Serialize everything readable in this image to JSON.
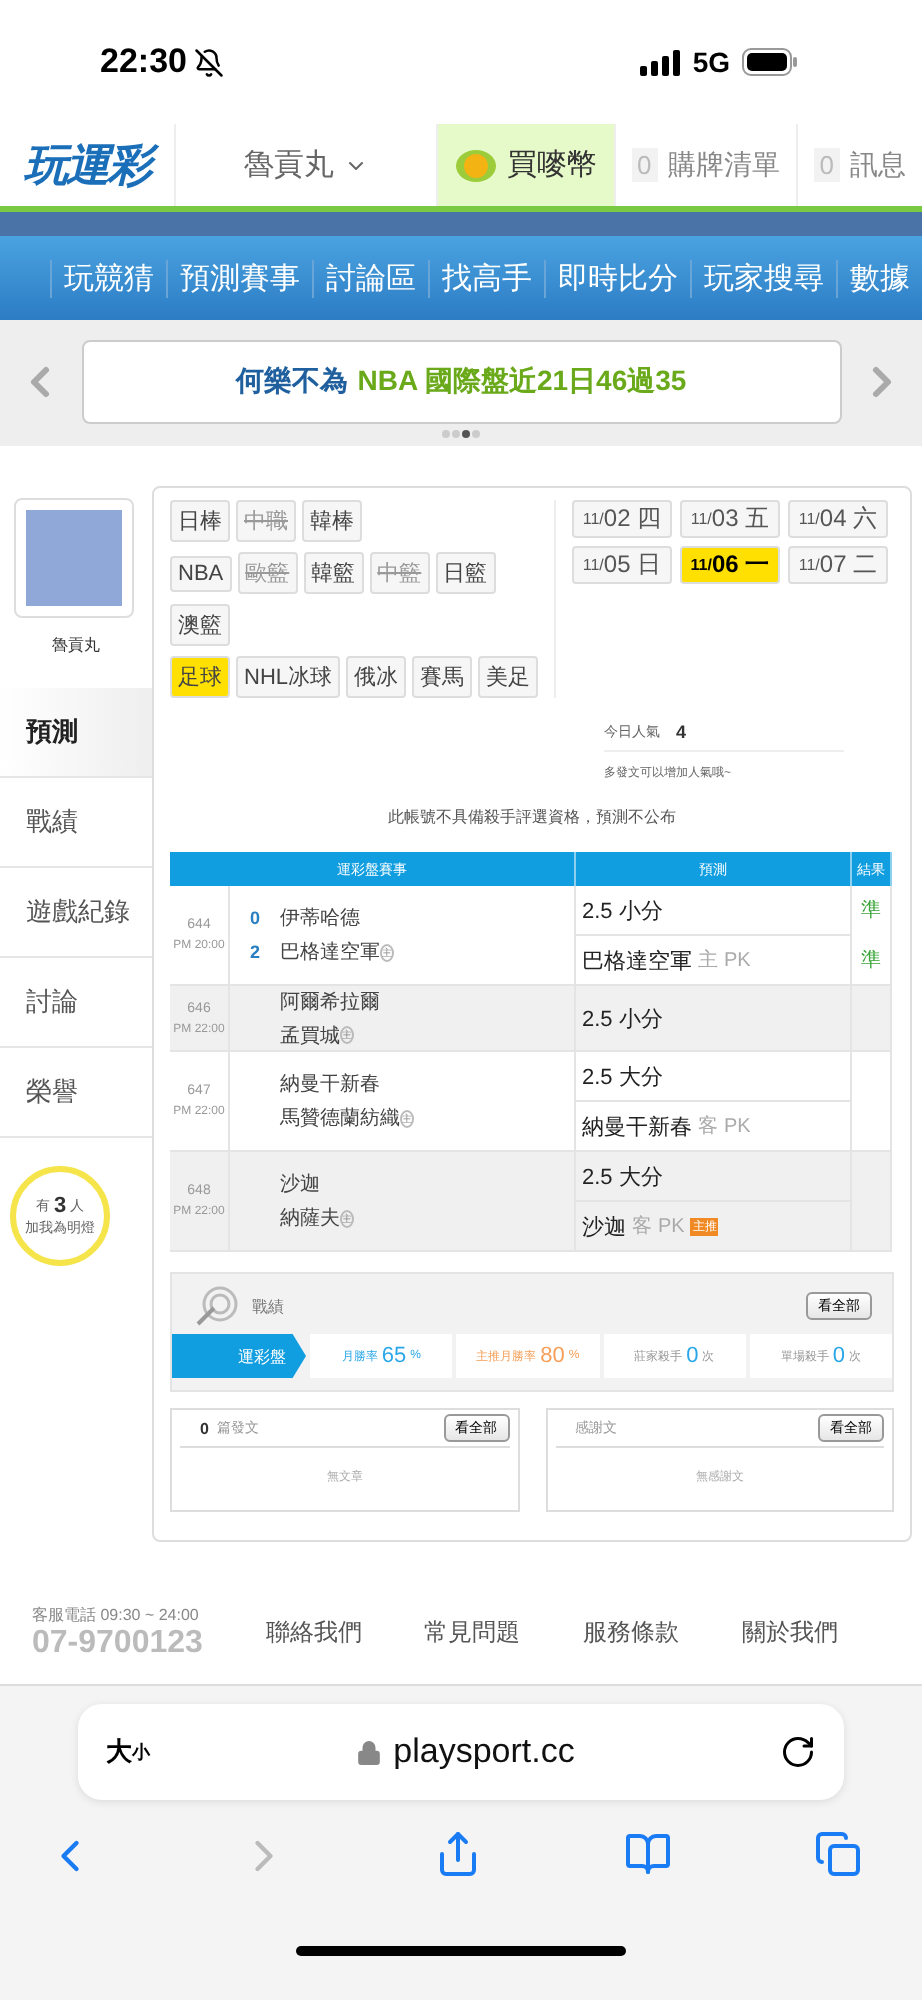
{
  "status_bar": {
    "time": "22:30",
    "network": "5G"
  },
  "header": {
    "logo": "玩運彩",
    "user": "魯貢丸",
    "coin": "買嘜幣",
    "cart": {
      "count": "0",
      "label": "購牌清單"
    },
    "messages": {
      "count": "0",
      "label": "訊息"
    }
  },
  "nav": [
    "玩競猜",
    "預測賽事",
    "討論區",
    "找高手",
    "即時比分",
    "玩家搜尋",
    "數據"
  ],
  "banner": {
    "name": "何樂不為",
    "highlight": "NBA 國際盤近21日46過35",
    "dots": [
      {
        "selected": false
      },
      {
        "selected": false
      },
      {
        "selected": true
      },
      {
        "selected": false
      }
    ]
  },
  "profile": {
    "name": "魯貢丸"
  },
  "side_tabs": [
    {
      "label": "預測",
      "selected": true
    },
    {
      "label": "戰績",
      "selected": false
    },
    {
      "label": "遊戲紀錄",
      "selected": false
    },
    {
      "label": "討論",
      "selected": false
    },
    {
      "label": "榮譽",
      "selected": false
    }
  ],
  "fans": {
    "prefix": "有",
    "count": "3",
    "suffix": "人",
    "label": "加我為明燈"
  },
  "sports": [
    [
      {
        "label": "日棒",
        "selected": false,
        "disabled": false
      },
      {
        "label": "中職",
        "selected": false,
        "disabled": true
      },
      {
        "label": "韓棒",
        "selected": false,
        "disabled": false
      }
    ],
    [
      {
        "label": "NBA",
        "selected": false,
        "disabled": false
      },
      {
        "label": "歐籃",
        "selected": false,
        "disabled": true
      },
      {
        "label": "韓籃",
        "selected": false,
        "disabled": false
      },
      {
        "label": "中籃",
        "selected": false,
        "disabled": true
      },
      {
        "label": "日籃",
        "selected": false,
        "disabled": false
      }
    ],
    [
      {
        "label": "澳籃",
        "selected": false,
        "disabled": false
      }
    ],
    [
      {
        "label": "足球",
        "selected": true,
        "disabled": false
      },
      {
        "label": "NHL冰球",
        "selected": false,
        "disabled": false
      },
      {
        "label": "俄冰",
        "selected": false,
        "disabled": false
      },
      {
        "label": "賽馬",
        "selected": false,
        "disabled": false
      },
      {
        "label": "美足",
        "selected": false,
        "disabled": false
      }
    ]
  ],
  "dates": [
    {
      "month": "11/",
      "day": "02",
      "weekday": "四",
      "selected": false
    },
    {
      "month": "11/",
      "day": "03",
      "weekday": "五",
      "selected": false
    },
    {
      "month": "11/",
      "day": "04",
      "weekday": "六",
      "selected": false
    },
    {
      "month": "11/",
      "day": "05",
      "weekday": "日",
      "selected": false
    },
    {
      "month": "11/",
      "day": "06",
      "weekday": "一",
      "selected": true
    },
    {
      "month": "11/",
      "day": "07",
      "weekday": "二",
      "selected": false
    }
  ],
  "popularity": {
    "label": "今日人氣",
    "value": "4",
    "hint": "多發文可以增加人氣哦~"
  },
  "notice": "此帳號不具備殺手評選資格，預測不公布",
  "table": {
    "columns": [
      "運彩盤賽事",
      "預測",
      "結果"
    ],
    "rows": [
      {
        "number": "644",
        "time": "PM 20:00",
        "away": {
          "name": "伊蒂哈德",
          "score": "0"
        },
        "home": {
          "name": "巴格達空軍",
          "score": "2",
          "mark": "主"
        },
        "predictions": [
          {
            "pick": "2.5 小分",
            "result": "準"
          },
          {
            "pick": "巴格達空軍",
            "side": "主",
            "line": "PK",
            "result": "準"
          }
        ]
      },
      {
        "number": "646",
        "time": "PM 22:00",
        "away": {
          "name": "阿爾希拉爾"
        },
        "home": {
          "name": "孟買城",
          "mark": "主"
        },
        "predictions": [
          {
            "pick": "2.5 小分"
          }
        ]
      },
      {
        "number": "647",
        "time": "PM 22:00",
        "away": {
          "name": "納曼干新春"
        },
        "home": {
          "name": "馬贊德蘭紡織",
          "mark": "主"
        },
        "predictions": [
          {
            "pick": "2.5 大分"
          },
          {
            "pick": "納曼干新春",
            "side": "客",
            "line": "PK"
          }
        ]
      },
      {
        "number": "648",
        "time": "PM 22:00",
        "away": {
          "name": "沙迦"
        },
        "home": {
          "name": "納薩夫",
          "mark": "主"
        },
        "predictions": [
          {
            "pick": "2.5 大分"
          },
          {
            "pick": "沙迦",
            "side": "客",
            "line": "PK",
            "badge": "主推"
          }
        ]
      }
    ]
  },
  "record": {
    "title": "戰績",
    "view_all": "看全部",
    "tab": "運彩盤",
    "stats": [
      {
        "label": "月勝率",
        "value": "65",
        "unit": "%",
        "color": "#2aa7e8"
      },
      {
        "label": "主推月勝率",
        "value": "80",
        "unit": "%",
        "color": "#f5a05a"
      },
      {
        "label": "莊家殺手",
        "value": "0",
        "unit": "次",
        "color": "#2aa7e8"
      },
      {
        "label": "單場殺手",
        "value": "0",
        "unit": "次",
        "color": "#2aa7e8"
      }
    ]
  },
  "posts": {
    "count": "0",
    "label": "篇發文",
    "view_all": "看全部",
    "empty": "無文章"
  },
  "thanks": {
    "label": "感謝文",
    "view_all": "看全部",
    "empty": "無感謝文"
  },
  "footer": {
    "service": "客服電話 09:30 ~ 24:00",
    "phone": "07-9700123",
    "links": [
      "聯絡我們",
      "常見問題",
      "服務條款",
      "關於我們"
    ]
  },
  "browser": {
    "text_size_big": "大",
    "text_size_small": "小",
    "url": "playsport.cc"
  }
}
